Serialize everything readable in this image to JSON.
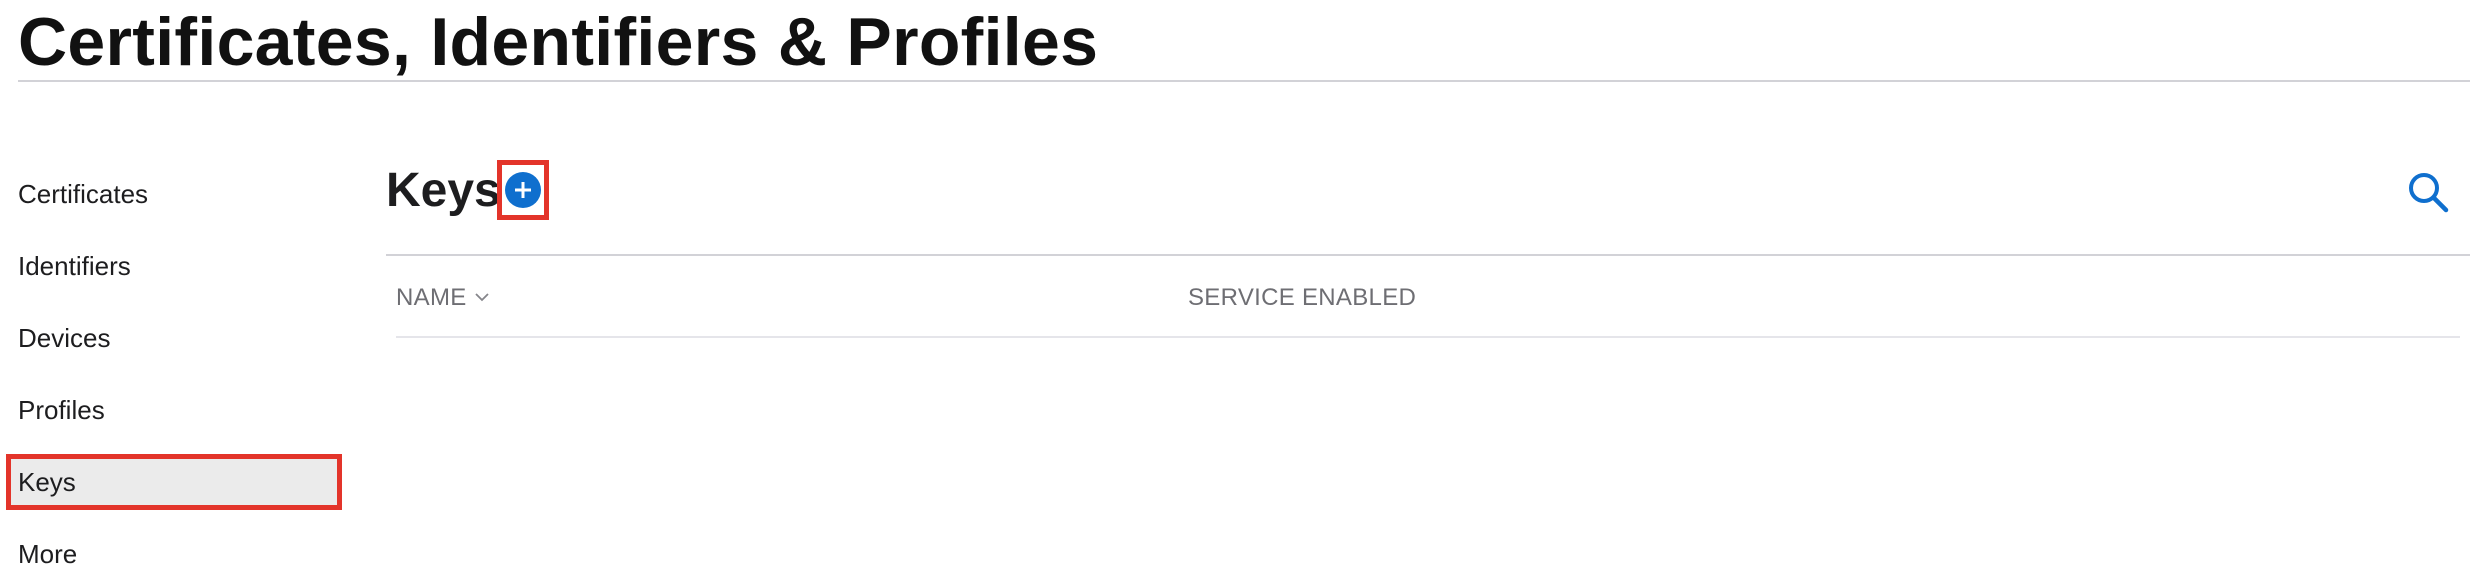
{
  "page": {
    "title": "Certificates, Identifiers & Profiles"
  },
  "sidebar": {
    "items": [
      {
        "label": "Certificates",
        "active": false
      },
      {
        "label": "Identifiers",
        "active": false
      },
      {
        "label": "Devices",
        "active": false
      },
      {
        "label": "Profiles",
        "active": false
      },
      {
        "label": "Keys",
        "active": true
      },
      {
        "label": "More",
        "active": false
      }
    ]
  },
  "main": {
    "section_title": "Keys",
    "add_button_icon": "plus-circle-icon",
    "search_icon": "search-icon",
    "table": {
      "columns": [
        {
          "label": "NAME",
          "sort_icon": "chevron-down-icon"
        },
        {
          "label": "SERVICE ENABLED"
        }
      ],
      "rows": []
    }
  },
  "colors": {
    "accent": "#0f6fce",
    "highlight_box": "#e3342a",
    "active_item_bg": "#ebebeb"
  }
}
